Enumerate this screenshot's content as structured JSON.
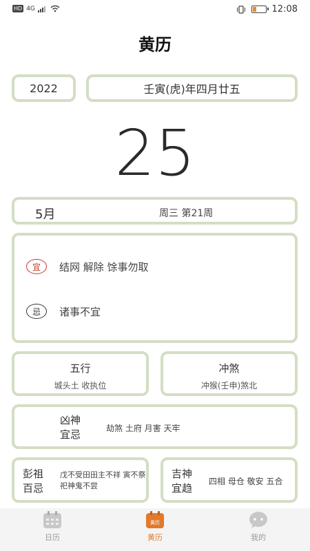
{
  "status_bar": {
    "hd": "HD",
    "signal": "4G",
    "time": "12:08"
  },
  "title": "黄历",
  "year": "2022",
  "lunar_date": "壬寅(虎)年四月廿五",
  "big_day": "25",
  "month": "5月",
  "week": "周三 第21周",
  "yi": {
    "label": "宜",
    "text": "结网 解除 馀事勿取"
  },
  "ji": {
    "label": "忌",
    "text": "诸事不宜"
  },
  "wuxing": {
    "title": "五行",
    "value": "城头土 收执位"
  },
  "chongsha": {
    "title": "冲煞",
    "value": "冲猴(壬申)煞北"
  },
  "xiongshen": {
    "title_line1": "凶神",
    "title_line2": "宜忌",
    "value": "劫煞 土府 月害 天牢"
  },
  "pengzu": {
    "title_line1": "彭祖",
    "title_line2": "百忌",
    "value": "戊不受田田主不祥 寅不祭祀神鬼不尝"
  },
  "jishen": {
    "title_line1": "吉神",
    "title_line2": "宜趋",
    "value": "四相 母仓 敬安 五合"
  },
  "nav": [
    {
      "label": "日历",
      "icon": "calendar-icon"
    },
    {
      "label": "黄历",
      "icon": "almanac-icon",
      "icon_text": "黄历"
    },
    {
      "label": "我的",
      "icon": "chat-bubble-icon"
    }
  ],
  "colors": {
    "border": "#d3dec4",
    "accent": "#e27a2c",
    "yi": "#c0392b"
  }
}
